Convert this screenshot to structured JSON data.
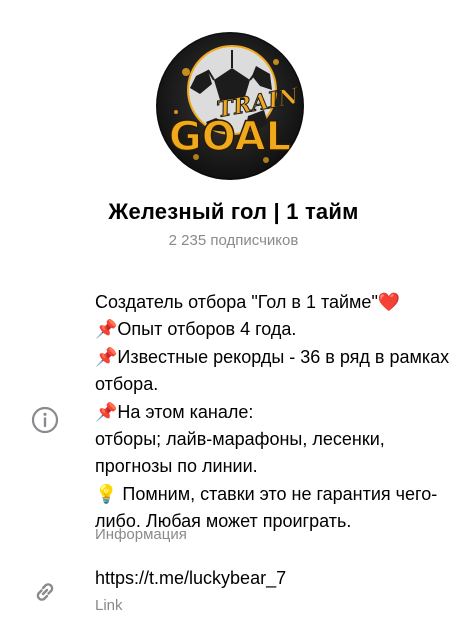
{
  "channel": {
    "title": "Железный гол | 1 тайм",
    "subscribers": "2 235 подписчиков",
    "avatar_logo_text": "TRAIN GOAL"
  },
  "info": {
    "icon": "info-icon",
    "description": "Создатель отбора \"Гол в 1 тайме\"❤️\n📌Опыт отборов 4 года.\n📌Известные рекорды - 36 в ряд в рамках отбора.\n📌На этом канале:\nотборы; лайв-марафоны, лесенки, прогнозы по линии.\n💡 Помним, ставки это не гарантия чего-либо. Любая может проиграть.",
    "caption": "Информация"
  },
  "link": {
    "icon": "link-icon",
    "url": "https://t.me/luckybear_7",
    "caption": "Link"
  },
  "colors": {
    "text": "#000000",
    "secondary": "#8a8a8e",
    "icon": "#8a8a8e",
    "avatar_accent": "#f0a81c"
  }
}
